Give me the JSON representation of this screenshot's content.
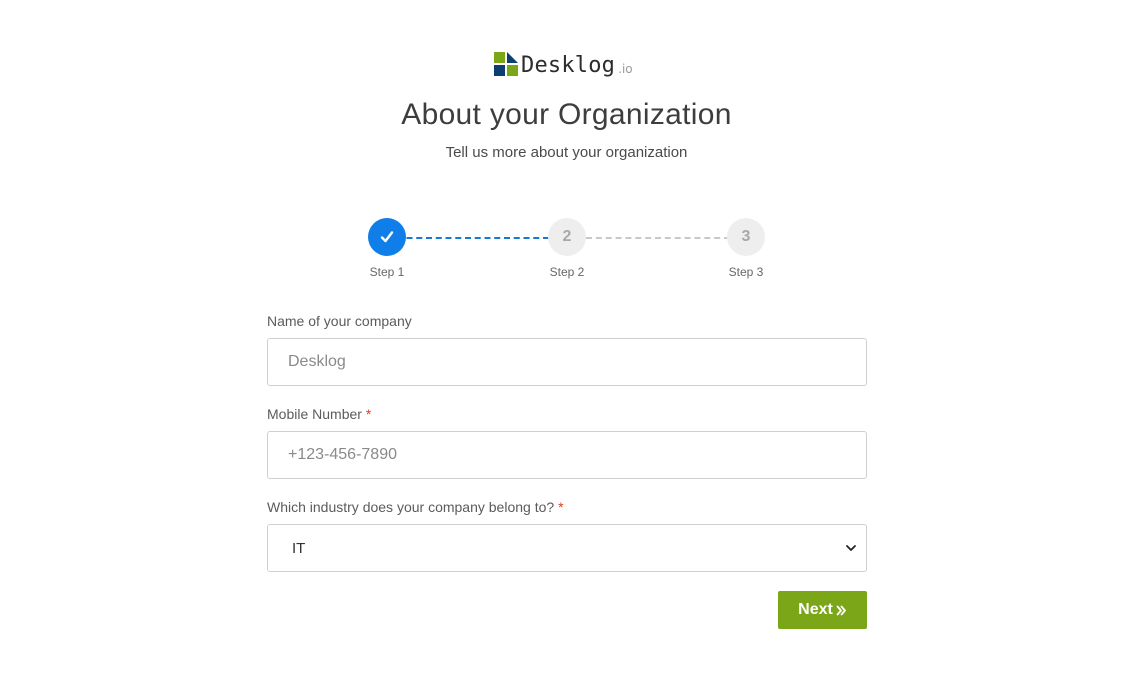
{
  "brand": {
    "name": "Desklog",
    "suffix": ".io",
    "colors": {
      "green": "#7aa617",
      "navy": "#0d3e70"
    }
  },
  "header": {
    "title": "About your Organization",
    "subtitle": "Tell us more about your organization"
  },
  "stepper": {
    "steps": [
      {
        "label": "Step 1",
        "number": "",
        "state": "completed"
      },
      {
        "label": "Step 2",
        "number": "2",
        "state": "pending"
      },
      {
        "label": "Step 3",
        "number": "3",
        "state": "pending"
      }
    ],
    "active_color": "#0f7ee8"
  },
  "form": {
    "company": {
      "label": "Name of your company",
      "placeholder": "Desklog"
    },
    "mobile": {
      "label": "Mobile Number",
      "required_mark": "*",
      "placeholder": "+123-456-7890"
    },
    "industry": {
      "label": "Which industry does your company belong to?",
      "required_mark": "*",
      "selected": "IT"
    },
    "next_label": "Next",
    "next_icon": "double-chevron-right-icon",
    "next_color": "#7aa618"
  }
}
